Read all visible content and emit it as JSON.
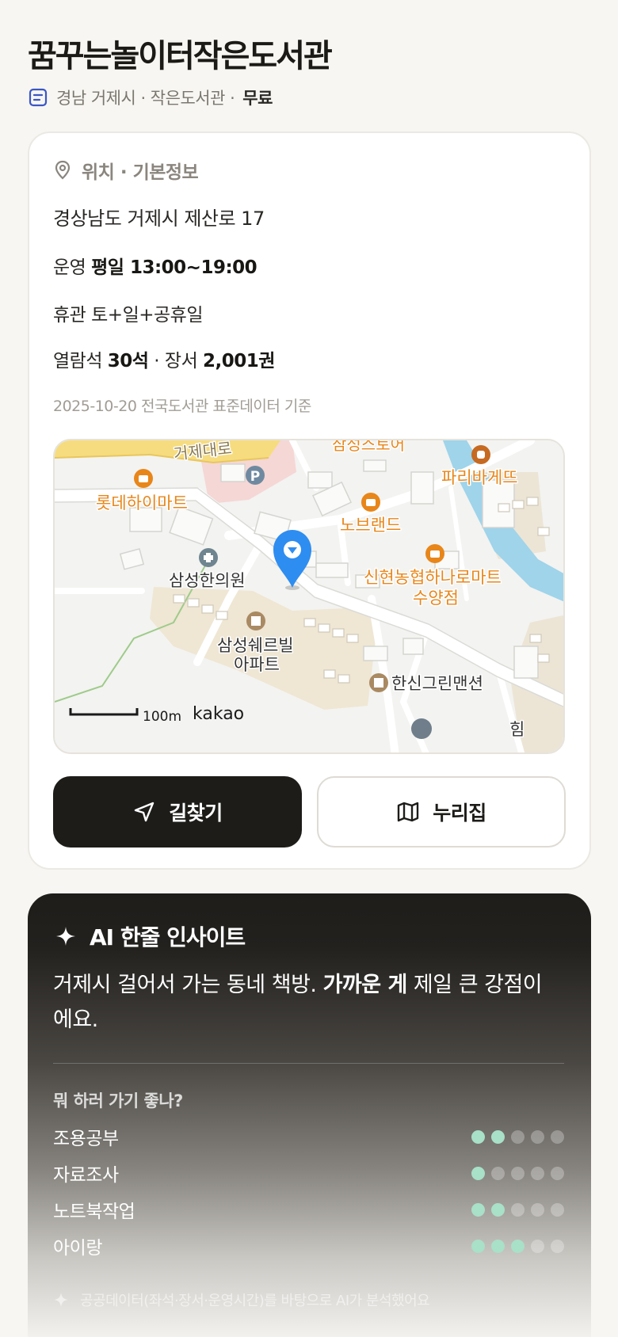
{
  "header": {
    "title": "꿈꾸는놀이터작은도서관",
    "meta_region": "경남 거제시 · 작은도서관 ·",
    "meta_fee": "무료"
  },
  "info": {
    "section_title": "위치 · 기본정보",
    "address": "경상남도 거제시 제산로 17",
    "hours_label": "운영",
    "hours_value": "평일 13:00~19:00",
    "closed_text": "휴관 토+일+공휴일",
    "seats_label": "열람석",
    "seats_value": "30석",
    "books_label": "· 장서",
    "books_value": "2,001권",
    "source": "2025-10-20 전국도서관 표준데이터 기준"
  },
  "map": {
    "labels": {
      "road": "거제대로",
      "store_top": "삼성스토어",
      "paris": "파리바게뜨",
      "lotte": "롯데하이마트",
      "noble": "노브랜드",
      "nh_line1": "신현농협하나로마트",
      "nh_line2": "수양점",
      "clinic": "삼성한의원",
      "apt_line1": "삼성쉐르빌",
      "apt_line2": "아파트",
      "hansin": "한신그린맨션",
      "edge": "힘",
      "scale": "100m",
      "brand": "kakao",
      "parking": "P"
    },
    "colors": {
      "food": "#e8861a",
      "road_yellow": "#f6dc7e",
      "water": "#9fd4ea",
      "pin": "#2e8df0",
      "apt_brown": "#a98a63"
    }
  },
  "actions": {
    "directions": "길찾기",
    "nurijip": "누리집"
  },
  "ai": {
    "title": "AI 한줄 인사이트",
    "body_pre": "거제시 걸어서 가는 동네 책방. ",
    "body_bold": "가까운 게",
    "body_post": " 제일 큰 강점이에요.",
    "question": "뭐 하러 가기 좋나?",
    "scores": [
      {
        "label": "조용공부",
        "value": 2,
        "max": 5
      },
      {
        "label": "자료조사",
        "value": 1,
        "max": 5
      },
      {
        "label": "노트북작업",
        "value": 2,
        "max": 5
      },
      {
        "label": "아이랑",
        "value": 3,
        "max": 5
      }
    ],
    "footnote": "공공데이터(좌석·장서·운영시간)를 바탕으로 AI가 분석했어요",
    "dot_on_color": "#a8e0c8"
  }
}
